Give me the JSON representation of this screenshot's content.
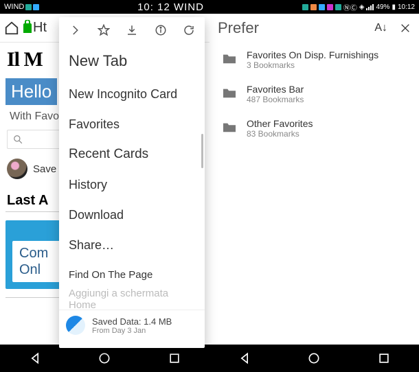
{
  "status": {
    "carrier": "WIND",
    "clock_center": "10: 12 WIND",
    "battery": "49%",
    "clock_right": "10:12"
  },
  "toolbar": {
    "url_fragment": "Ht"
  },
  "page": {
    "masthead": "Il M",
    "hero": "Hello",
    "subtitle": "With Favorites",
    "save_history": "Save History",
    "last": "Last A",
    "card1": "Com",
    "card2": "Onl"
  },
  "menu": {
    "items": [
      {
        "label": "New Tab"
      },
      {
        "label": "New Incognito Card"
      },
      {
        "label": "Favorites"
      },
      {
        "label": "Recent Cards"
      },
      {
        "label": "History"
      },
      {
        "label": "Download"
      },
      {
        "label": "Share…"
      },
      {
        "label": "Find On The Page"
      },
      {
        "label": "Aggiungi a schermata Home"
      }
    ],
    "saved_title": "Saved Data: 1.4 MB",
    "saved_sub": "From Day 3 Jan"
  },
  "prefer": {
    "title": "Prefer",
    "sort": "A↓",
    "folders": [
      {
        "name": "Favorites On Disp. Furnishings",
        "count": "3 Bookmarks"
      },
      {
        "name": "Favorites Bar",
        "count": "487 Bookmarks"
      },
      {
        "name": "Other Favorites",
        "count": "83 Bookmarks"
      }
    ]
  }
}
